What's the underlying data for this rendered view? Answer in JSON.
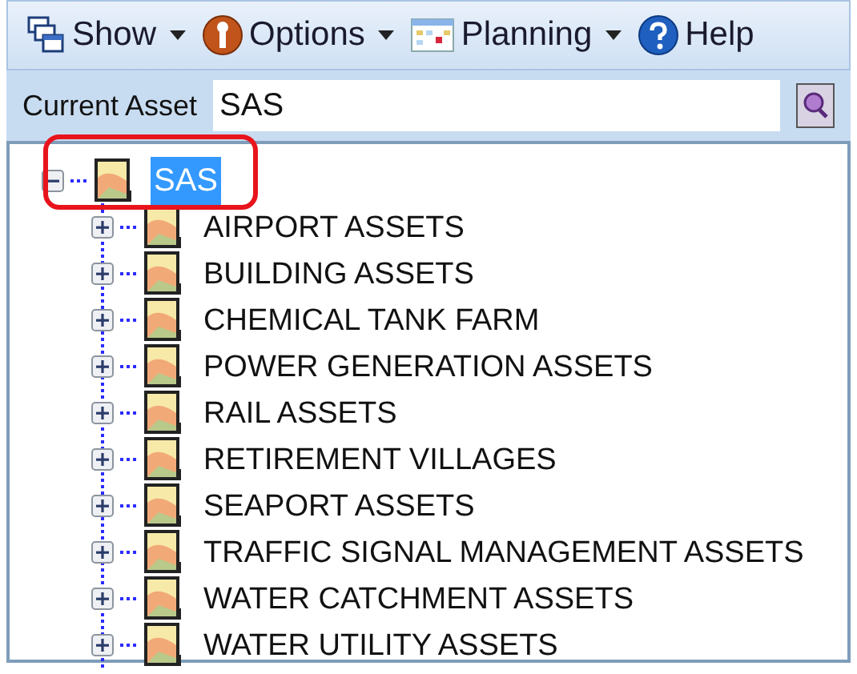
{
  "toolbar": [
    {
      "kind": "windows",
      "label": "Show",
      "dropdown": true
    },
    {
      "kind": "options",
      "label": "Options",
      "dropdown": true
    },
    {
      "kind": "calendar",
      "label": "Planning",
      "dropdown": true
    },
    {
      "kind": "help",
      "label": "Help",
      "dropdown": false
    }
  ],
  "current_asset": {
    "label": "Current Asset",
    "value": "SAS"
  },
  "tree": {
    "label": "SAS",
    "expanded": true,
    "selected": true,
    "children": [
      {
        "label": "AIRPORT ASSETS",
        "expanded": false
      },
      {
        "label": "BUILDING ASSETS",
        "expanded": false
      },
      {
        "label": "CHEMICAL TANK FARM",
        "expanded": false
      },
      {
        "label": "POWER GENERATION ASSETS",
        "expanded": false
      },
      {
        "label": "RAIL ASSETS",
        "expanded": false
      },
      {
        "label": "RETIREMENT VILLAGES",
        "expanded": false
      },
      {
        "label": "SEAPORT ASSETS",
        "expanded": false
      },
      {
        "label": "TRAFFIC SIGNAL MANAGEMENT ASSETS",
        "expanded": false
      },
      {
        "label": "WATER CATCHMENT ASSETS",
        "expanded": false
      },
      {
        "label": "WATER UTILITY ASSETS",
        "expanded": false
      }
    ]
  },
  "annotation": {
    "kind": "highlight"
  }
}
